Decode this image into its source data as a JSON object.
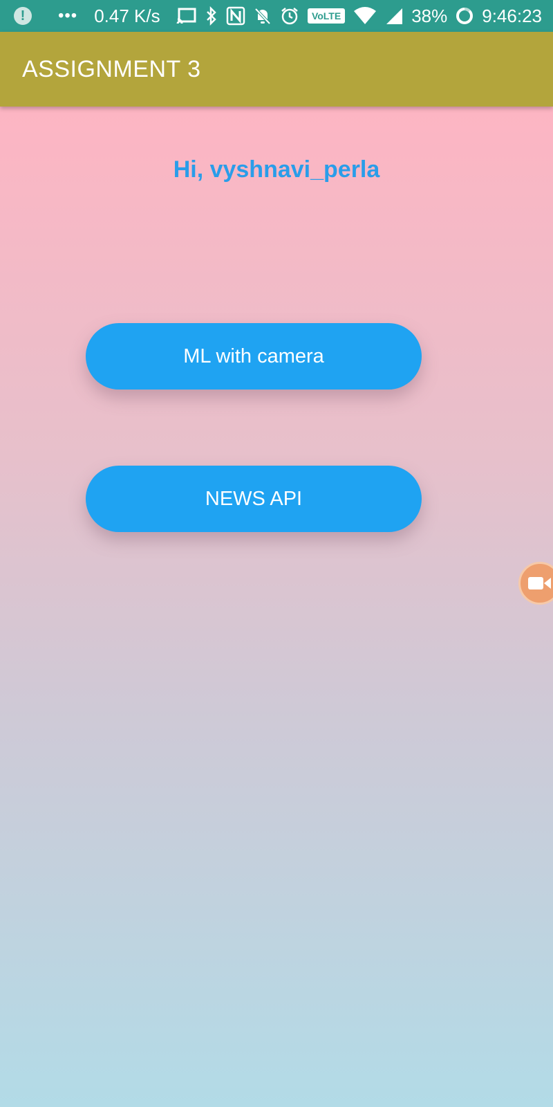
{
  "status_bar": {
    "speed": "0.47 K/s",
    "volte": "VoLTE",
    "battery": "38%",
    "time": "9:46:23",
    "color": "#2d9c8e"
  },
  "app_bar": {
    "title": "ASSIGNMENT 3",
    "color": "#b3a53c"
  },
  "main": {
    "greeting": "Hi, vyshnavi_perla",
    "buttons": [
      {
        "label": "ML with camera"
      },
      {
        "label": "NEWS API"
      }
    ],
    "accent_color": "#1fa3f2"
  },
  "icons": {
    "status": [
      "alert-icon",
      "more-icon",
      "cast-icon",
      "bluetooth-icon",
      "nfc-icon",
      "notifications-off-icon",
      "alarm-icon",
      "wifi-icon",
      "signal-icon",
      "battery-saver-icon"
    ],
    "floating": "video-camera-icon"
  }
}
